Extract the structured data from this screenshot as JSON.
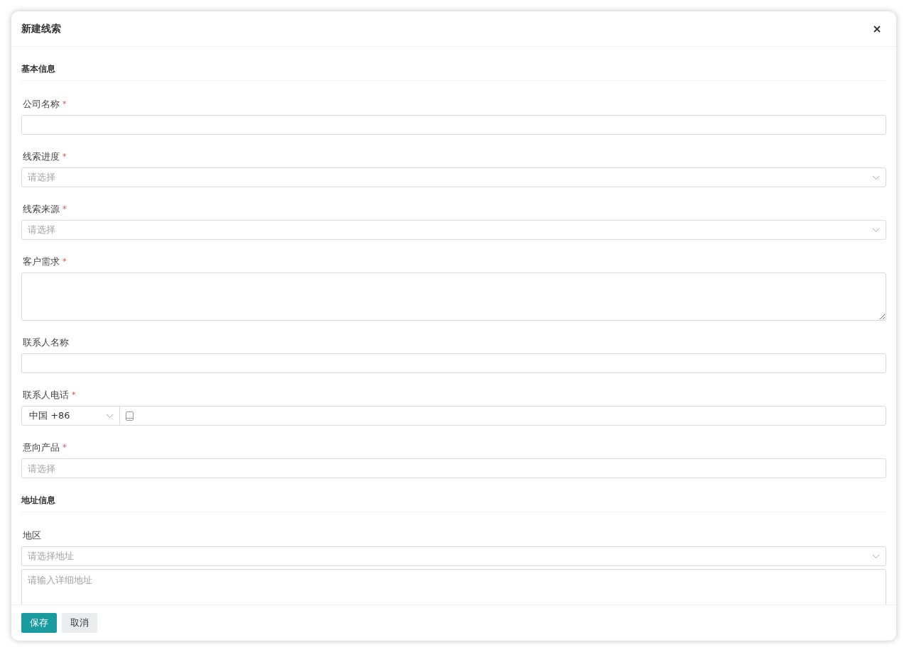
{
  "dialog": {
    "title": "新建线索"
  },
  "required_mark": "*",
  "sections": [
    {
      "title": "基本信息",
      "fields": [
        {
          "kind": "text",
          "label": "公司名称",
          "required": true
        },
        {
          "kind": "select",
          "label": "线索进度",
          "required": true,
          "placeholder": "请选择"
        },
        {
          "kind": "select",
          "label": "线索来源",
          "required": true,
          "placeholder": "请选择"
        },
        {
          "kind": "textarea",
          "label": "客户需求",
          "required": true
        },
        {
          "kind": "text",
          "label": "联系人名称",
          "required": false
        },
        {
          "kind": "phone",
          "label": "联系人电话",
          "required": true,
          "country_code": "中国 +86"
        },
        {
          "kind": "text",
          "label": "意向产品",
          "required": true,
          "placeholder": "请选择"
        }
      ]
    },
    {
      "title": "地址信息",
      "fields": [
        {
          "kind": "address",
          "label": "地区",
          "required": false,
          "placeholder": "请选择地址",
          "detail_placeholder": "请输入详细地址"
        }
      ]
    }
  ],
  "buttons": [
    {
      "label": "保存",
      "kind": "primary"
    },
    {
      "label": "取消",
      "kind": "secondary"
    }
  ]
}
